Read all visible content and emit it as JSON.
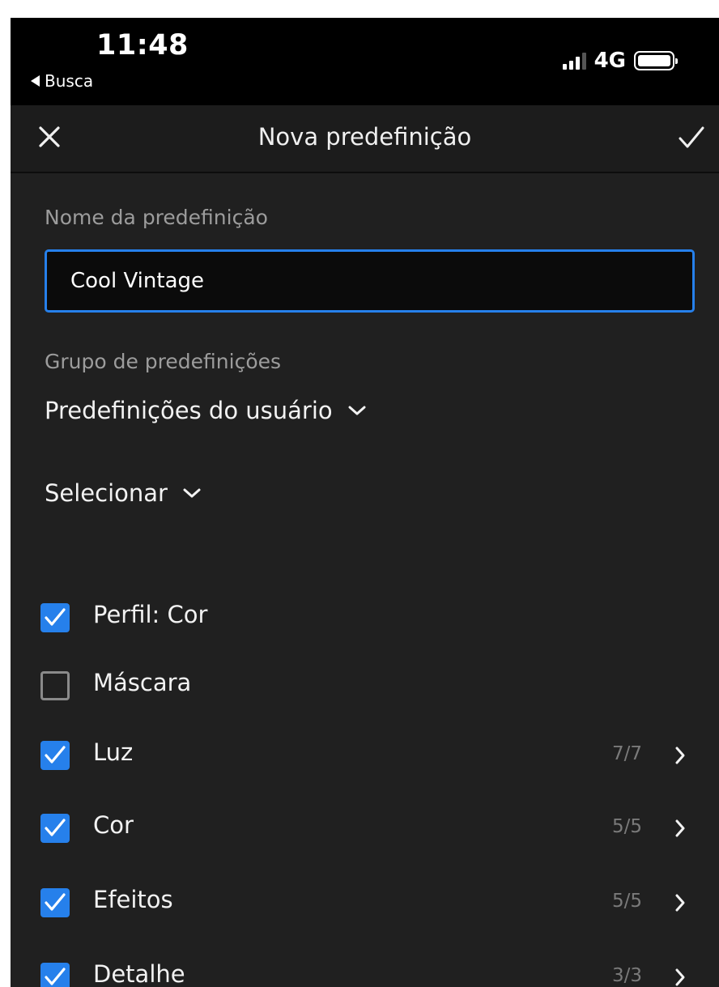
{
  "status_bar": {
    "time": "11:48",
    "back_label": "Busca",
    "network": "4G"
  },
  "header": {
    "title": "Nova predefinição",
    "close_icon": "close-icon",
    "confirm_icon": "checkmark-icon"
  },
  "form": {
    "name_label": "Nome da predefinição",
    "name_value": "Cool Vintage",
    "group_label": "Grupo de predefinições",
    "group_value": "Predefinições do usuário",
    "select_label": "Selecionar"
  },
  "settings": [
    {
      "label": "Perfil: Cor",
      "checked": true,
      "count": ""
    },
    {
      "label": "Máscara",
      "checked": false,
      "count": ""
    },
    {
      "label": "Luz",
      "checked": true,
      "count": "7/7"
    },
    {
      "label": "Cor",
      "checked": true,
      "count": "5/5"
    },
    {
      "label": "Efeitos",
      "checked": true,
      "count": "5/5"
    },
    {
      "label": "Detalhe",
      "checked": true,
      "count": "3/3"
    }
  ],
  "colors": {
    "accent": "#2680eb",
    "background": "#202020",
    "header_background": "#1c1c1c"
  }
}
